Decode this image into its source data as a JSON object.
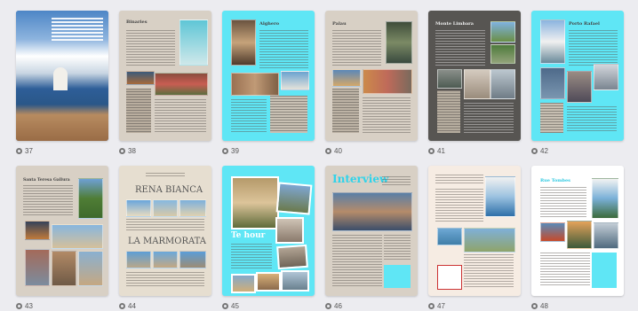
{
  "theme": {
    "bg": "#ececf0",
    "cyan": "#5fe6f5",
    "beige": "#d8d0c5",
    "dark": "#575552",
    "cream": "#f6ece3"
  },
  "pages": [
    {
      "number": "37",
      "title": ""
    },
    {
      "number": "38",
      "title": "Binaries"
    },
    {
      "number": "39",
      "title": "Alghero"
    },
    {
      "number": "40",
      "title": "Palau"
    },
    {
      "number": "41",
      "title": "Monte Limbara"
    },
    {
      "number": "42",
      "title": "Porto Rafael"
    },
    {
      "number": "43",
      "title": "Santa Teresa Gallura"
    },
    {
      "number": "44",
      "title": "",
      "headline_top": "RENA BIANCA",
      "headline_bottom": "LA MARMORATA"
    },
    {
      "number": "45",
      "title": "",
      "headline": "Te hour"
    },
    {
      "number": "46",
      "title": "",
      "headline": "Interview"
    },
    {
      "number": "47",
      "title": ""
    },
    {
      "number": "48",
      "title": "Rue Tombes"
    }
  ]
}
